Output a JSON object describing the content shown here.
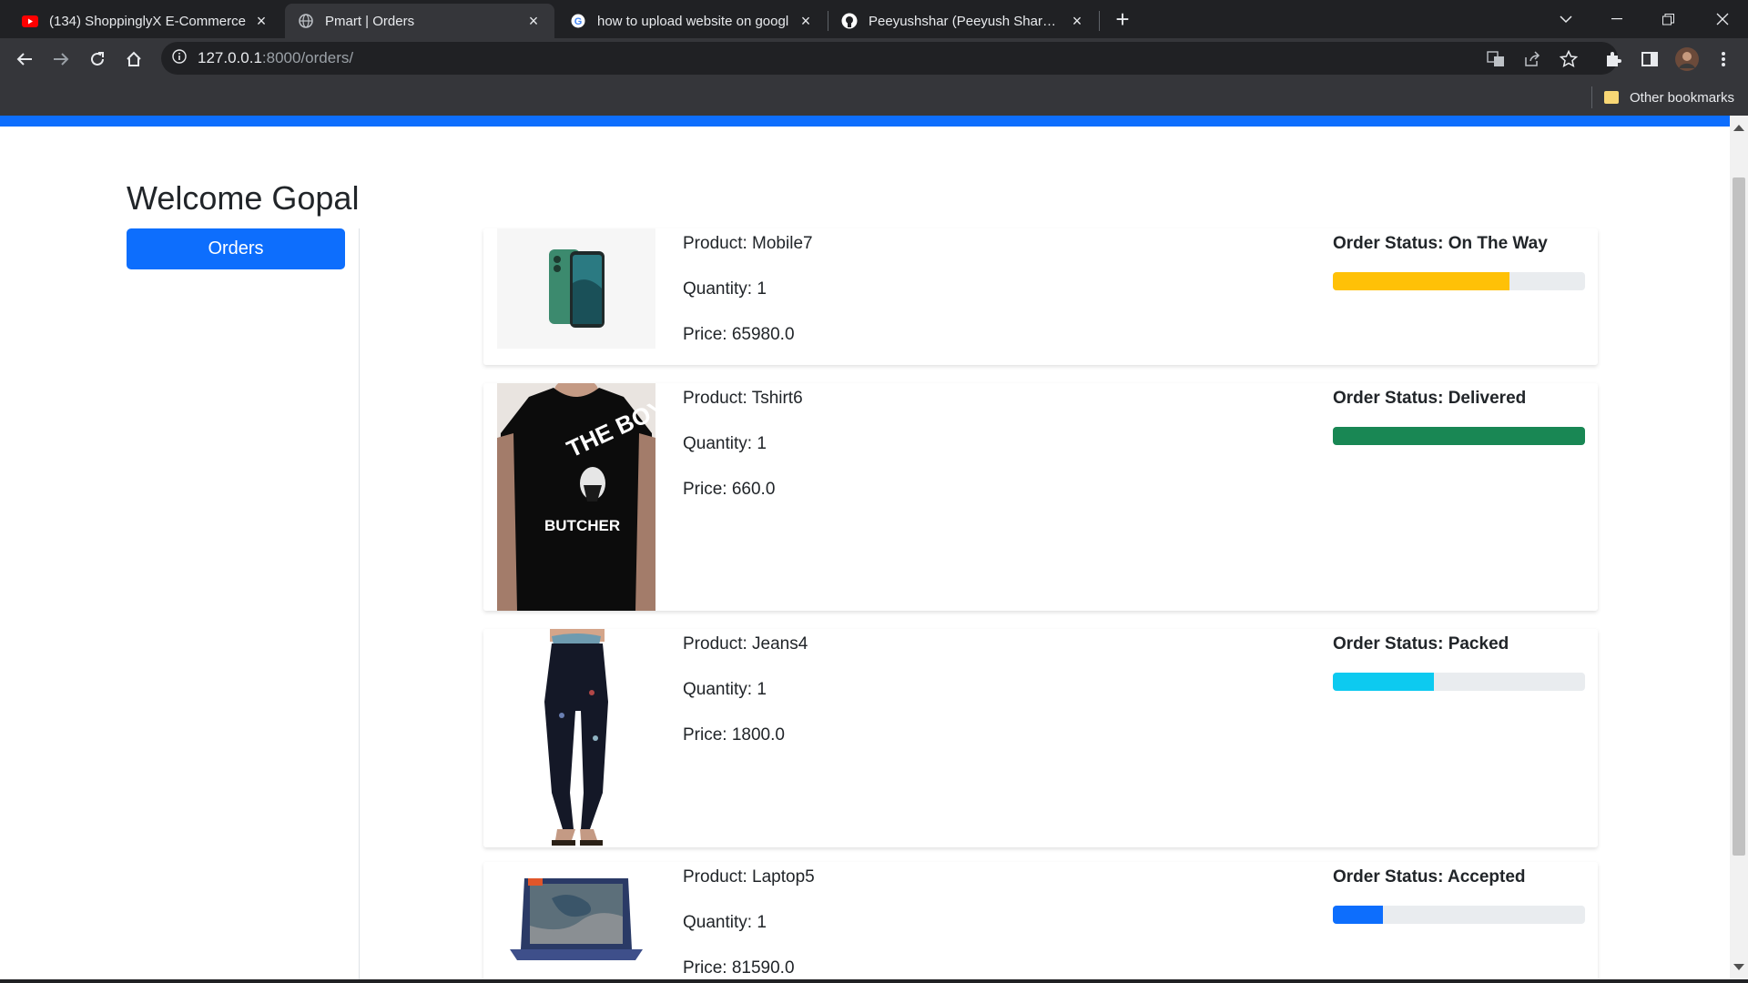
{
  "browser": {
    "tabs": [
      {
        "title": "(134) ShoppinglyX E-Commerce",
        "favicon": "youtube-icon",
        "active": false
      },
      {
        "title": "Pmart | Orders",
        "favicon": "globe-icon",
        "active": true
      },
      {
        "title": "how to upload website on googl",
        "favicon": "google-icon",
        "active": false
      },
      {
        "title": "Peeyushshar (Peeyush Sharma) ·",
        "favicon": "github-icon",
        "active": false
      }
    ],
    "url_host": "127.0.0.1",
    "url_path": ":8000/orders/",
    "bookmarks_label": "Other bookmarks"
  },
  "page": {
    "welcome": "Welcome Gopal",
    "orders_button": "Orders"
  },
  "orders": [
    {
      "product": "Product: Mobile7",
      "quantity": "Quantity: 1",
      "price": "Price: 65980.0",
      "status": "Order Status: On The Way",
      "progress_percent": 70,
      "color": "#ffc107",
      "image": "smartphone"
    },
    {
      "product": "Product: Tshirt6",
      "quantity": "Quantity: 1",
      "price": "Price: 660.0",
      "status": "Order Status: Delivered",
      "progress_percent": 100,
      "color": "#198754",
      "image": "tshirt"
    },
    {
      "product": "Product: Jeans4",
      "quantity": "Quantity: 1",
      "price": "Price: 1800.0",
      "status": "Order Status: Packed",
      "progress_percent": 40,
      "color": "#0dcaf0",
      "image": "jeans"
    },
    {
      "product": "Product: Laptop5",
      "quantity": "Quantity: 1",
      "price": "Price: 81590.0",
      "status": "Order Status: Accepted",
      "progress_percent": 20,
      "color": "#0d6efd",
      "image": "laptop"
    }
  ]
}
